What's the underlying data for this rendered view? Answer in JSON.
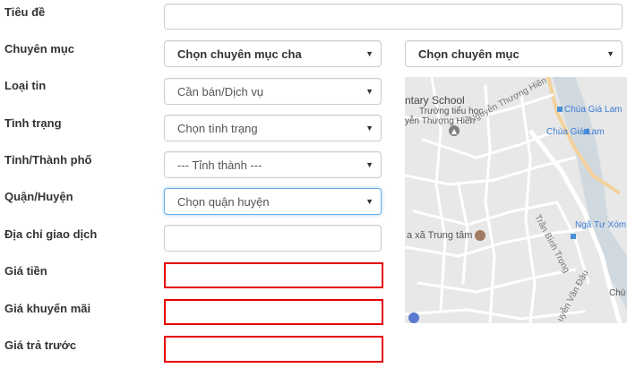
{
  "labels": {
    "tieu_de": "Tiêu đề",
    "chuyen_muc": "Chuyên mục",
    "loai_tin": "Loại tin",
    "tinh_trang": "Tình trạng",
    "tinh_thanh_pho": "Tỉnh/Thành phố",
    "quan_huyen": "Quận/Huyện",
    "dia_chi": "Địa chỉ giao dịch",
    "gia_tien": "Giá tiền",
    "gia_khuyen_mai": "Giá khuyến mãi",
    "gia_tra_truoc": "Giá trả trước"
  },
  "fields": {
    "tieu_de_value": "",
    "chuyen_muc_cha": "Chọn chuyên mục cha",
    "chuyen_muc": "Chọn chuyên mục",
    "loai_tin": "Cần bán/Dịch vụ",
    "tinh_trang": "Chọn tình trạng",
    "tinh_thanh": "--- Tỉnh thành ---",
    "quan_huyen": "Chọn quận huyện",
    "dia_chi_value": "",
    "gia_tien_value": "",
    "gia_khuyen_mai_value": "",
    "gia_tra_truoc_value": ""
  },
  "map": {
    "labels": {
      "school_en": "ntary School",
      "school_vi_1": "Trường tiểu học",
      "school_vi_2": "yễn Thượng Hiền",
      "street_nth": "Nguyễn Thượng Hiền",
      "chua_gia_lam_1": "Chùa Giá Lam",
      "chua_gia_lam_2": "Chùa Giá Lam",
      "tran_binh_trong": "Trần Bình Trọng",
      "nga_tu_xom": "Ngã Tư Xóm",
      "trung_tam": "a xã Trung tâm",
      "nguyen_van_dau": "uyễn Văn Đậu",
      "chu": "Chù"
    }
  },
  "colors": {
    "error_border": "#e60000",
    "focus_border": "#66afe9",
    "map_bg": "#e8e8e8"
  }
}
